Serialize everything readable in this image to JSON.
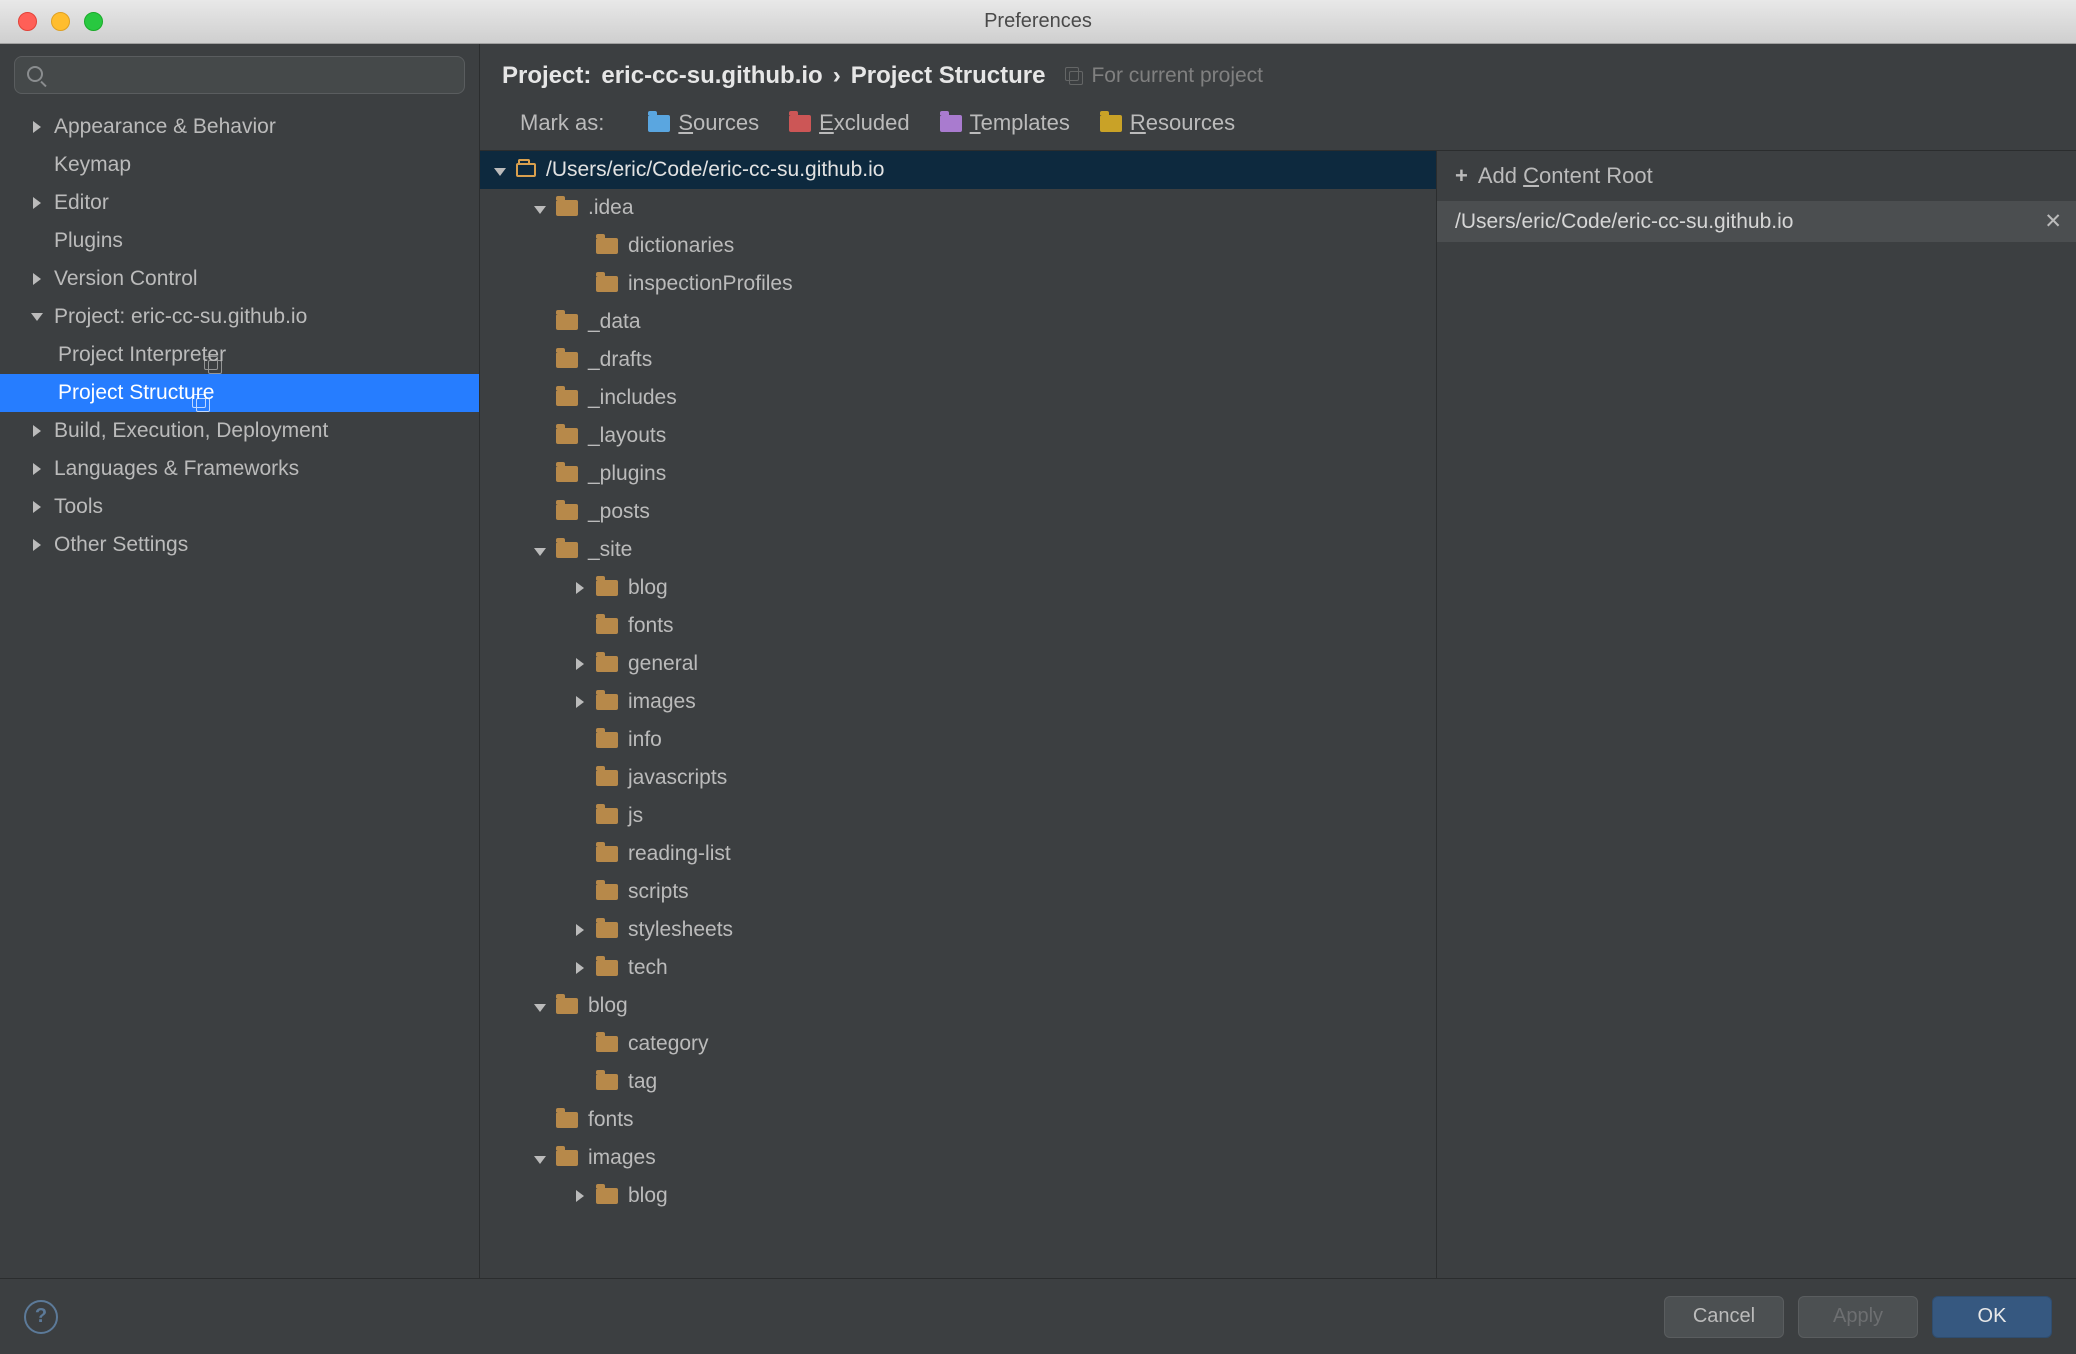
{
  "window": {
    "title": "Preferences"
  },
  "search": {
    "placeholder": ""
  },
  "sidebar": {
    "items": [
      {
        "label": "Appearance & Behavior",
        "expandable": true,
        "depth": 0
      },
      {
        "label": "Keymap",
        "expandable": false,
        "depth": 0
      },
      {
        "label": "Editor",
        "expandable": true,
        "depth": 0
      },
      {
        "label": "Plugins",
        "expandable": false,
        "depth": 0
      },
      {
        "label": "Version Control",
        "expandable": true,
        "depth": 0
      },
      {
        "label": "Project: eric-cc-su.github.io",
        "expandable": true,
        "depth": 0,
        "expanded": true
      },
      {
        "label": "Project Interpreter",
        "expandable": false,
        "depth": 1,
        "trailing": "copy"
      },
      {
        "label": "Project Structure",
        "expandable": false,
        "depth": 1,
        "selected": true,
        "trailing": "copy"
      },
      {
        "label": "Build, Execution, Deployment",
        "expandable": true,
        "depth": 0
      },
      {
        "label": "Languages & Frameworks",
        "expandable": true,
        "depth": 0
      },
      {
        "label": "Tools",
        "expandable": true,
        "depth": 0
      },
      {
        "label": "Other Settings",
        "expandable": true,
        "depth": 0
      }
    ]
  },
  "breadcrumb": {
    "project_prefix": "Project:",
    "project_name": "eric-cc-su.github.io",
    "separator": "›",
    "page": "Project Structure",
    "scope": "For current project"
  },
  "markas": {
    "label": "Mark as:",
    "sources": "Sources",
    "excluded": "Excluded",
    "templates": "Templates",
    "resources": "Resources"
  },
  "tree": [
    {
      "depth": 0,
      "label": "/Users/eric/Code/eric-cc-su.github.io",
      "expanded": true,
      "selected": true,
      "outline": true
    },
    {
      "depth": 1,
      "label": ".idea",
      "expanded": true
    },
    {
      "depth": 2,
      "label": "dictionaries"
    },
    {
      "depth": 2,
      "label": "inspectionProfiles"
    },
    {
      "depth": 1,
      "label": "_data"
    },
    {
      "depth": 1,
      "label": "_drafts"
    },
    {
      "depth": 1,
      "label": "_includes"
    },
    {
      "depth": 1,
      "label": "_layouts"
    },
    {
      "depth": 1,
      "label": "_plugins"
    },
    {
      "depth": 1,
      "label": "_posts"
    },
    {
      "depth": 1,
      "label": "_site",
      "expanded": true
    },
    {
      "depth": 2,
      "label": "blog",
      "expandable": true
    },
    {
      "depth": 2,
      "label": "fonts"
    },
    {
      "depth": 2,
      "label": "general",
      "expandable": true
    },
    {
      "depth": 2,
      "label": "images",
      "expandable": true
    },
    {
      "depth": 2,
      "label": "info"
    },
    {
      "depth": 2,
      "label": "javascripts"
    },
    {
      "depth": 2,
      "label": "js"
    },
    {
      "depth": 2,
      "label": "reading-list"
    },
    {
      "depth": 2,
      "label": "scripts"
    },
    {
      "depth": 2,
      "label": "stylesheets",
      "expandable": true
    },
    {
      "depth": 2,
      "label": "tech",
      "expandable": true
    },
    {
      "depth": 1,
      "label": "blog",
      "expanded": true
    },
    {
      "depth": 2,
      "label": "category"
    },
    {
      "depth": 2,
      "label": "tag"
    },
    {
      "depth": 1,
      "label": "fonts"
    },
    {
      "depth": 1,
      "label": "images",
      "expanded": true
    },
    {
      "depth": 2,
      "label": "blog",
      "expandable": true
    }
  ],
  "roots": {
    "add_label_pre": "Add ",
    "add_label_mnem": "C",
    "add_label_post": "ontent Root",
    "entries": [
      {
        "path": "/Users/eric/Code/eric-cc-su.github.io"
      }
    ]
  },
  "footer": {
    "cancel": "Cancel",
    "apply": "Apply",
    "ok": "OK"
  }
}
